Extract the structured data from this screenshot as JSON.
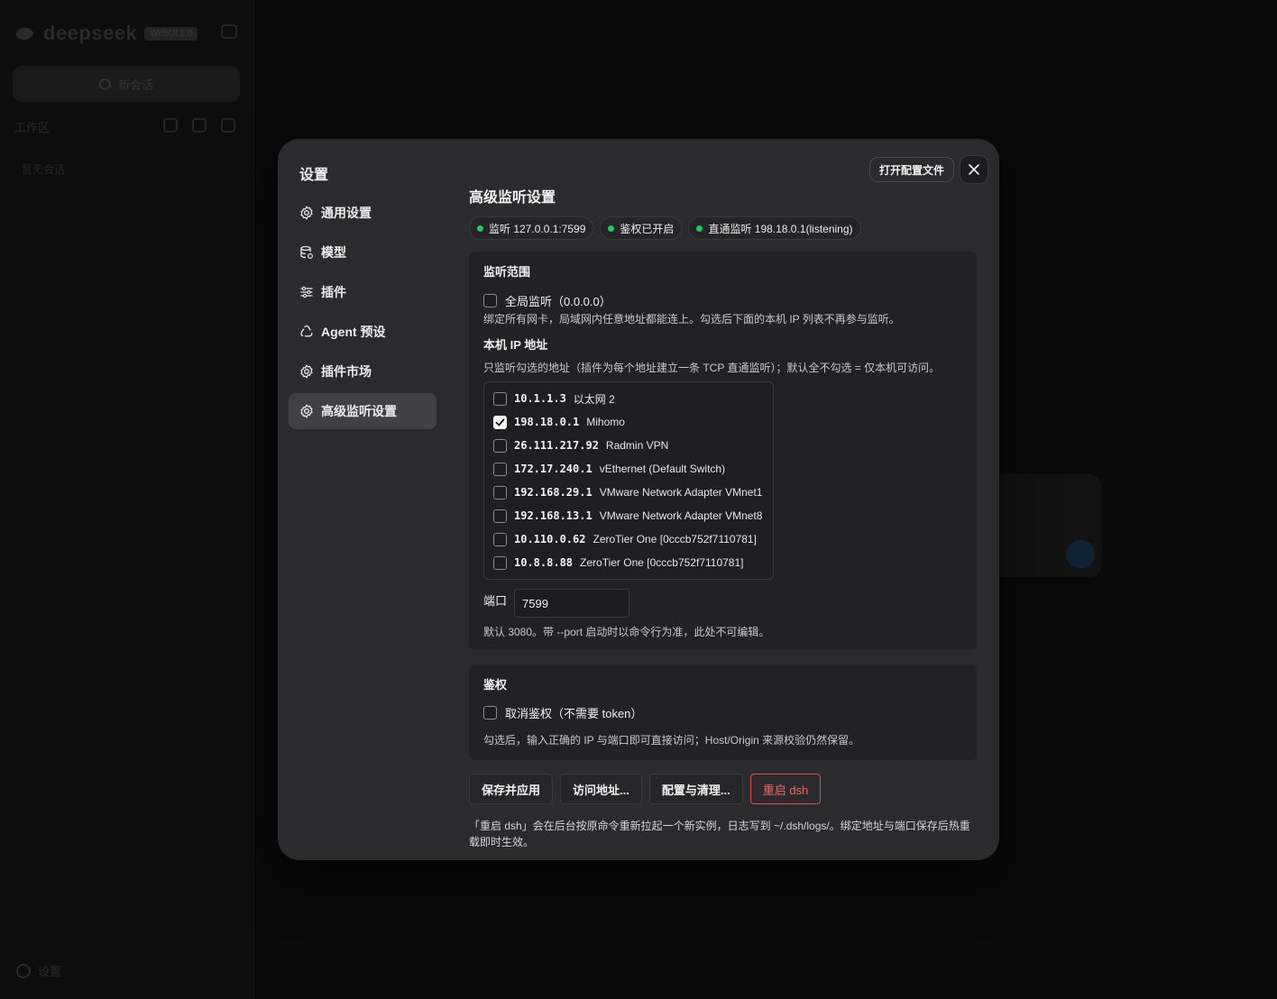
{
  "background": {
    "brand": "deepseek",
    "version_badge": "WebUI 2.0",
    "new_chat_label": "新会话",
    "workspace_label": "工作区",
    "empty_label": "暂无会话",
    "settings_label": "设置"
  },
  "modal": {
    "title": "设置",
    "open_config_label": "打开配置文件",
    "nav": [
      {
        "label": "通用设置",
        "icon": "gear-icon"
      },
      {
        "label": "模型",
        "icon": "database-icon"
      },
      {
        "label": "插件",
        "icon": "sliders-icon"
      },
      {
        "label": "Agent 预设",
        "icon": "recycle-icon"
      },
      {
        "label": "插件市场",
        "icon": "gear-icon"
      },
      {
        "label": "高级监听设置",
        "icon": "gear-icon",
        "active": true
      }
    ]
  },
  "page": {
    "title": "高级监听设置",
    "badges": [
      {
        "text": "监听 127.0.0.1:7599",
        "color": "#22c55e"
      },
      {
        "text": "鉴权已开启",
        "color": "#22c55e"
      },
      {
        "text": "直通监听 198.18.0.1(listening)",
        "color": "#22c55e"
      }
    ],
    "listen": {
      "heading": "监听范围",
      "global_label": "全局监听（0.0.0.0）",
      "global_checked": false,
      "global_hint": "绑定所有网卡，局域网内任意地址都能连上。勾选后下面的本机 IP 列表不再参与监听。",
      "local_heading": "本机 IP 地址",
      "local_hint": "只监听勾选的地址（插件为每个地址建立一条 TCP 直通监听）；默认全不勾选 = 仅本机可访问。",
      "ips": [
        {
          "addr": "10.1.1.3",
          "name": "以太网 2",
          "checked": false
        },
        {
          "addr": "198.18.0.1",
          "name": "Mihomo",
          "checked": true
        },
        {
          "addr": "26.111.217.92",
          "name": "Radmin VPN",
          "checked": false
        },
        {
          "addr": "172.17.240.1",
          "name": "vEthernet (Default Switch)",
          "checked": false
        },
        {
          "addr": "192.168.29.1",
          "name": "VMware Network Adapter VMnet1",
          "checked": false
        },
        {
          "addr": "192.168.13.1",
          "name": "VMware Network Adapter VMnet8",
          "checked": false
        },
        {
          "addr": "10.110.0.62",
          "name": "ZeroTier One [0cccb752f7110781]",
          "checked": false
        },
        {
          "addr": "10.8.8.88",
          "name": "ZeroTier One [0cccb752f7110781]",
          "checked": false
        }
      ],
      "port_label": "端口",
      "port_value": "7599",
      "port_hint": "默认 3080。带 --port 启动时以命令行为准，此处不可编辑。"
    },
    "auth": {
      "heading": "鉴权",
      "disable_label": "取消鉴权（不需要 token）",
      "disable_checked": false,
      "hint": "勾选后，输入正确的 IP 与端口即可直接访问；Host/Origin 来源校验仍然保留。"
    },
    "actions": {
      "save": "保存并应用",
      "access": "访问地址...",
      "config": "配置与清理...",
      "restart": "重启 dsh"
    },
    "footnote": "「重启 dsh」会在后台按原命令重新拉起一个新实例，日志写到 ~/.dsh/logs/。绑定地址与端口保存后热重载即时生效。"
  },
  "colors": {
    "modal_bg": "#2b2b2d",
    "panel_bg": "#222224",
    "active_nav": "#414144",
    "status_green": "#22c55e",
    "danger": "#dc5050"
  }
}
